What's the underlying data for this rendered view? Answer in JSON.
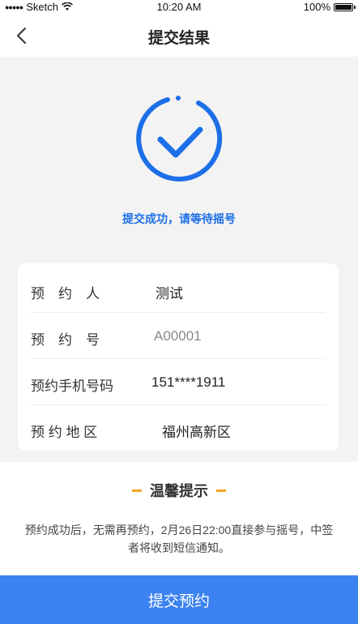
{
  "status_bar": {
    "carrier": "Sketch",
    "time": "10:20 AM",
    "battery": "100%"
  },
  "nav": {
    "title": "提交结果"
  },
  "result": {
    "message": "提交成功，请等待摇号"
  },
  "info": [
    {
      "label": "预　约　人",
      "value": "测试"
    },
    {
      "label": "预　约　号",
      "value": "A00001"
    },
    {
      "label": "预约手机号码",
      "value": "151****1911"
    },
    {
      "label": "预 约 地 区",
      "value": "福州高新区"
    }
  ],
  "tips": {
    "title": "温馨提示",
    "body": "预约成功后，无需再预约，2月26日22:00直接参与摇号，中签者将收到短信通知。"
  },
  "footer": {
    "submit_label": "提交预约"
  },
  "colors": {
    "accent": "#1c6fe8",
    "button": "#3c82f0",
    "tips_dash": "#f5a623"
  }
}
